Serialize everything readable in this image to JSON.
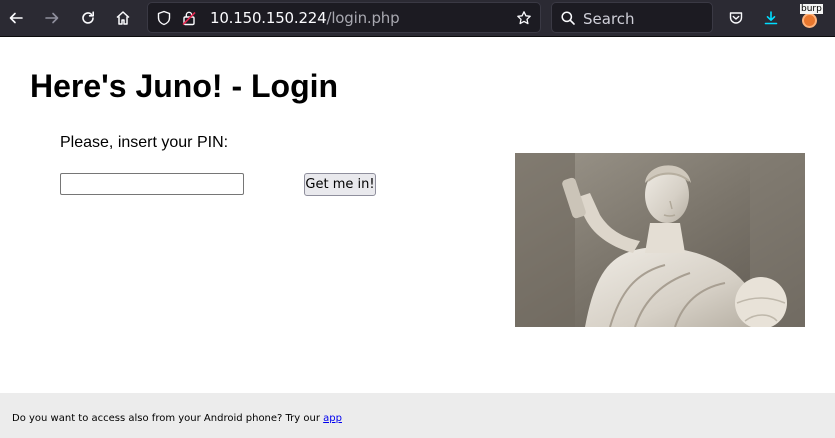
{
  "browser": {
    "url_host": "10.150.150.224",
    "url_path": "/login.php",
    "search_placeholder": "Search",
    "extension_label": "burp"
  },
  "page": {
    "title": "Here's Juno! - Login",
    "pin_prompt": "Please, insert your PIN:",
    "pin_value": "",
    "submit_label": "Get me in!",
    "image_alt": "Statue of Juno"
  },
  "footer": {
    "text": "Do you want to access also from your Android phone? Try our",
    "link_label": "app"
  },
  "colors": {
    "toolbar_bg": "#2b2a33",
    "footer_bg": "#ececec",
    "link": "#0000ee"
  }
}
